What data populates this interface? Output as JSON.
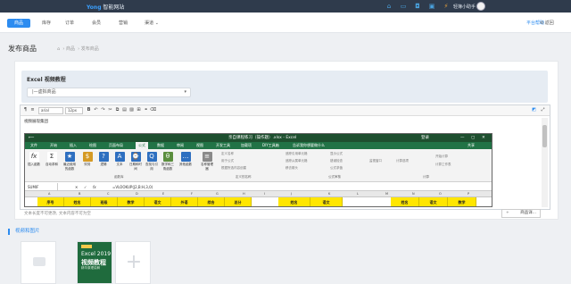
{
  "topbar": {
    "logo_mark": "Yong",
    "logo_text": "智能网站",
    "username": "轻簿小助手",
    "icons": [
      "home-icon",
      "monitor-icon",
      "chat-icon",
      "desktop-icon",
      "alert-icon",
      "bolt-icon",
      "bell-icon"
    ]
  },
  "menu": {
    "tabs": [
      {
        "label": "商品",
        "active": true
      },
      {
        "label": "库存"
      },
      {
        "label": "订单"
      },
      {
        "label": "会员"
      },
      {
        "label": "营销"
      },
      {
        "label": "渠道"
      }
    ],
    "help_label": "平台帮助",
    "back_label": "返回"
  },
  "page": {
    "title": "发布商品",
    "breadcrumb": [
      "商品",
      "发布商品"
    ]
  },
  "product": {
    "title": "Excel 视频教程",
    "category_value": "|—虚拟商品"
  },
  "editor": {
    "toolbar": {
      "font_name": "arial",
      "font_size": "12px"
    },
    "section_label": "视频展现集团",
    "status_text": "文本长度不可更改, 文本内容不可为空",
    "media_button_label": "商品详..."
  },
  "excel": {
    "window_title": "亲自课程练习（操作题）.xlsx - Excel",
    "user_label": "登录",
    "ribbon_tabs": [
      "文件",
      "开始",
      "插入",
      "绘图",
      "页面布局",
      "公式",
      "数据",
      "审阅",
      "视图",
      "开发工具",
      "加载项",
      "DIY工具箱",
      "告诉我你想要做什么"
    ],
    "active_tab": "公式",
    "share_label": "共享",
    "buttons": [
      {
        "label": "插入函数",
        "icon": "fx"
      },
      {
        "label": "自动求和",
        "icon": "Σ"
      },
      {
        "label": "最近使用的函数",
        "icon": "★"
      },
      {
        "label": "财务",
        "icon": "$"
      },
      {
        "label": "逻辑",
        "icon": "?"
      },
      {
        "label": "文本",
        "icon": "A"
      },
      {
        "label": "日期和时间",
        "icon": "⌚"
      },
      {
        "label": "查找与引用",
        "icon": "Q"
      },
      {
        "label": "数学和三角函数",
        "icon": "θ"
      },
      {
        "label": "其他函数",
        "icon": "…"
      },
      {
        "label": "名称管理器",
        "icon": "≡"
      }
    ],
    "small_items": [
      "定义名称",
      "用于公式",
      "根据所选内容创建",
      "追踪引用单元格",
      "追踪从属单元格",
      "移去箭头",
      "显示公式",
      "错误检查",
      "公式求值",
      "监视窗口",
      "计算选项",
      "开始计算",
      "计算工作表"
    ],
    "group_labels": [
      "函数库",
      "定义的名称",
      "公式审核",
      "计算"
    ],
    "name_box": "SUMIF",
    "formula": "=VLOOKUP(J2,B:H,3,0)",
    "columns": [
      "A",
      "B",
      "C",
      "D",
      "E",
      "F",
      "G",
      "H",
      "I",
      "J",
      "K",
      "L",
      "M",
      "N",
      "O",
      "P"
    ],
    "header_row": [
      "序号",
      "姓名",
      "班级",
      "数学",
      "语文",
      "外语",
      "综合",
      "总分",
      "",
      "姓名",
      "语文",
      "",
      "姓名",
      "语文",
      "数学"
    ]
  },
  "media": {
    "heading": "视频和图片",
    "cover_badge": "",
    "cover_line1": "Excel 2019",
    "cover_line2": "视频教程",
    "cover_line3": "精华原理讲解"
  }
}
